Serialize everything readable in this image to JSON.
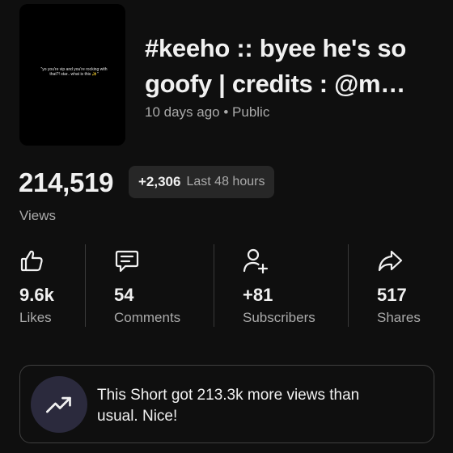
{
  "video": {
    "thumbnail_caption": "\"yo you're vip and you're rocking with that?! star.. what is this ✨\"",
    "title": "#keeho :: byee he's so goofy | credits : @m…",
    "meta": "10 days ago • Public"
  },
  "views": {
    "count": "214,519",
    "delta_value": "+2,306",
    "delta_label": "Last 48 hours",
    "label": "Views"
  },
  "stats": [
    {
      "value": "9.6k",
      "label": "Likes",
      "icon": "thumbs-up-icon"
    },
    {
      "value": "54",
      "label": "Comments",
      "icon": "comment-icon"
    },
    {
      "value": "+81",
      "label": "Subscribers",
      "icon": "add-person-icon"
    },
    {
      "value": "517",
      "label": "Shares",
      "icon": "share-icon"
    }
  ],
  "insight": {
    "icon": "trending-up-icon",
    "text": "This Short got 213.3k more views than usual. Nice!"
  },
  "colors": {
    "background": "#0f0f0f",
    "chip": "#272727",
    "secondary_text": "#aaaaaa",
    "insight_badge": "#2b2a3d"
  }
}
